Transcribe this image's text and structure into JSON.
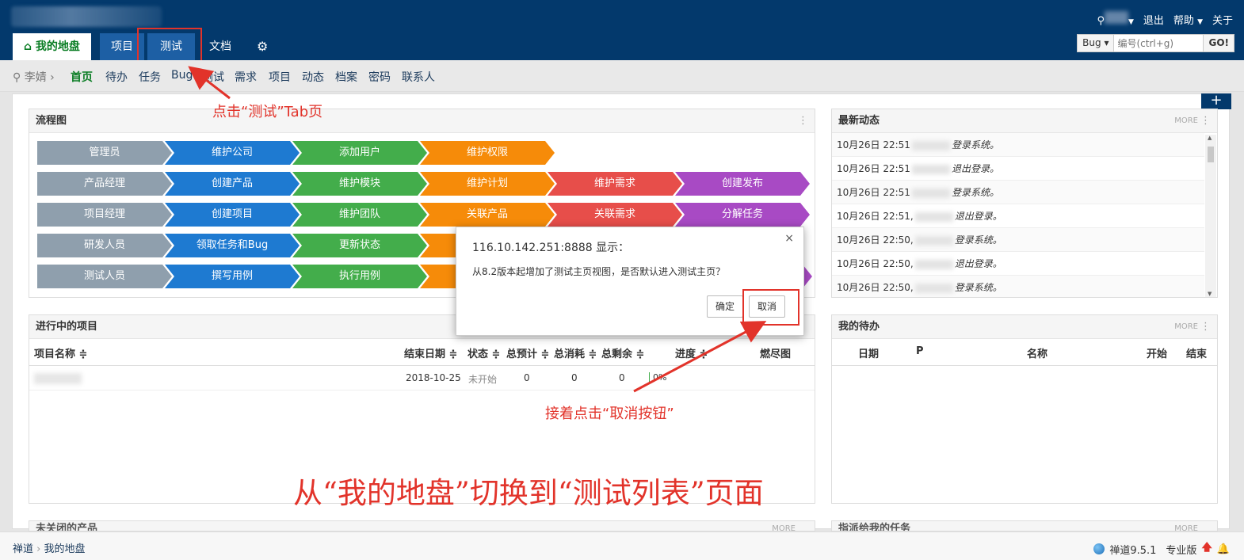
{
  "header": {
    "tabs": [
      "我的地盘",
      "项目",
      "测试",
      "文档"
    ],
    "home_icon": "home-icon",
    "settings_icon": "gear-icon",
    "user_icon": "user-icon",
    "logout": "退出",
    "help": "帮助",
    "about": "关于",
    "search_type": "Bug",
    "search_placeholder": "编号(ctrl+g)",
    "search_go": "GO!"
  },
  "subnav": {
    "user": "李婧",
    "items": [
      "首页",
      "待办",
      "任务",
      "Bug",
      "测试",
      "需求",
      "项目",
      "动态",
      "档案",
      "密码",
      "联系人"
    ]
  },
  "flow_panel": {
    "title": "流程图",
    "rows": [
      [
        "管理员",
        "维护公司",
        "添加用户",
        "维护权限"
      ],
      [
        "产品经理",
        "创建产品",
        "维护模块",
        "维护计划",
        "维护需求",
        "创建发布"
      ],
      [
        "项目经理",
        "创建项目",
        "维护团队",
        "关联产品",
        "关联需求",
        "分解任务"
      ],
      [
        "研发人员",
        "领取任务和Bug",
        "更新状态"
      ],
      [
        "测试人员",
        "撰写用例",
        "执行用例"
      ]
    ]
  },
  "dynamics_panel": {
    "title": "最新动态",
    "more": "MORE",
    "items": [
      {
        "time": "10月26日 22:51",
        "action": "登录系统。"
      },
      {
        "time": "10月26日 22:51",
        "action": "退出登录。"
      },
      {
        "time": "10月26日 22:51",
        "action": "登录系统。"
      },
      {
        "time": "10月26日 22:51,",
        "action": "退出登录。"
      },
      {
        "time": "10月26日 22:50,",
        "action": "登录系统。"
      },
      {
        "time": "10月26日 22:50,",
        "action": "退出登录。"
      },
      {
        "time": "10月26日 22:50,",
        "action": "登录系统。"
      }
    ]
  },
  "projects_panel": {
    "title": "进行中的项目",
    "columns": [
      "项目名称 ≑",
      "结束日期 ≑",
      "状态 ≑",
      "总预计 ≑",
      "总消耗 ≑",
      "总剩余 ≑",
      "进度 ≑",
      "燃尽图"
    ],
    "row": {
      "end": "2018-10-25",
      "status": "未开始",
      "estimate": "0",
      "consumed": "0",
      "left": "0",
      "progress": "0%"
    }
  },
  "todo_panel": {
    "title": "我的待办",
    "more": "MORE",
    "columns": [
      "日期",
      "P",
      "名称",
      "开始",
      "结束"
    ]
  },
  "bottom_panels": {
    "left_title": "未关闭的产品",
    "right_title": "指派给我的任务",
    "more": "MORE"
  },
  "dialog": {
    "title": "116.10.142.251:8888 显示：",
    "message": "从8.2版本起增加了测试主页视图，是否默认进入测试主页？",
    "ok": "确定",
    "cancel": "取消",
    "close": "×"
  },
  "annotations": {
    "tab_hint": "点击“测试”Tab页",
    "cancel_hint": "接着点击“取消按钮”",
    "caption": "从“我的地盘”切换到“测试列表”页面"
  },
  "footer": {
    "crumb1": "禅道",
    "crumb2": "我的地盘",
    "version": "禅道9.5.1",
    "edition": "专业版"
  },
  "colors": {
    "header": "#03396c",
    "annotation": "#e2332a",
    "active_green": "#0a7d24"
  }
}
